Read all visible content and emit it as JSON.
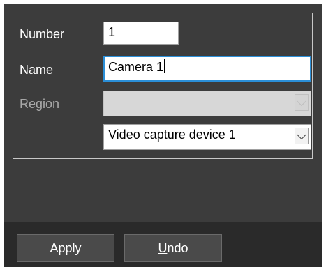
{
  "form": {
    "number_label": "Number",
    "number_value": "1",
    "name_label": "Name",
    "name_value": "Camera 1",
    "region_label": "Region",
    "region_value": "",
    "device_value": "Video capture device 1"
  },
  "buttons": {
    "apply_label": "Apply",
    "undo_first": "U",
    "undo_rest": "ndo"
  },
  "colors": {
    "panel": "#3c3c3c",
    "bottombar": "#2a2a2a",
    "focus_border": "#2b8fd8"
  }
}
